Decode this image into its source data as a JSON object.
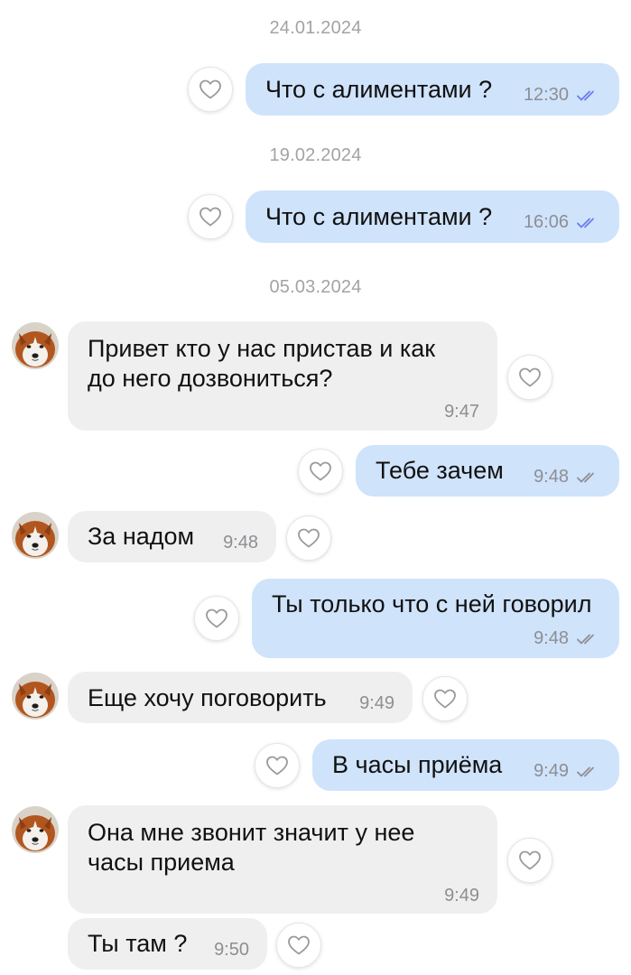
{
  "chat": {
    "dates": [
      "24.01.2024",
      "19.02.2024",
      "05.03.2024"
    ],
    "messages": [
      {
        "direction": "out",
        "text": "Что с алиментами ?",
        "time": "12:30",
        "status": "read"
      },
      {
        "direction": "out",
        "text": "Что с алиментами ?",
        "time": "16:06",
        "status": "read"
      },
      {
        "direction": "in",
        "text": "Привет кто у нас пристав и как\nдо него дозвониться?",
        "time": "9:47"
      },
      {
        "direction": "out",
        "text": "Тебе зачем",
        "time": "9:48",
        "status": "delivered"
      },
      {
        "direction": "in",
        "text": "За надом",
        "time": "9:48"
      },
      {
        "direction": "out",
        "text": "Ты только что с ней говорил",
        "time": "9:48",
        "status": "delivered"
      },
      {
        "direction": "in",
        "text": "Еще хочу поговорить",
        "time": "9:49"
      },
      {
        "direction": "out",
        "text": "В часы приёма",
        "time": "9:49",
        "status": "delivered"
      },
      {
        "direction": "in",
        "text": "Она мне звонит значит у нее\nчасы приема",
        "time": "9:49"
      },
      {
        "direction": "in",
        "text": "Ты там ?",
        "time": "9:50"
      }
    ]
  },
  "icons": {
    "like": "heart-outline-icon",
    "read_receipt": "double-check-icon",
    "avatar": "akita-dog-avatar"
  },
  "colors": {
    "outgoing_bubble": "#cfe3fb",
    "incoming_bubble": "#efefef",
    "read_check": "#6a7cf2",
    "delivered_check": "#8e8e93",
    "date_text": "#a3a3a3"
  }
}
